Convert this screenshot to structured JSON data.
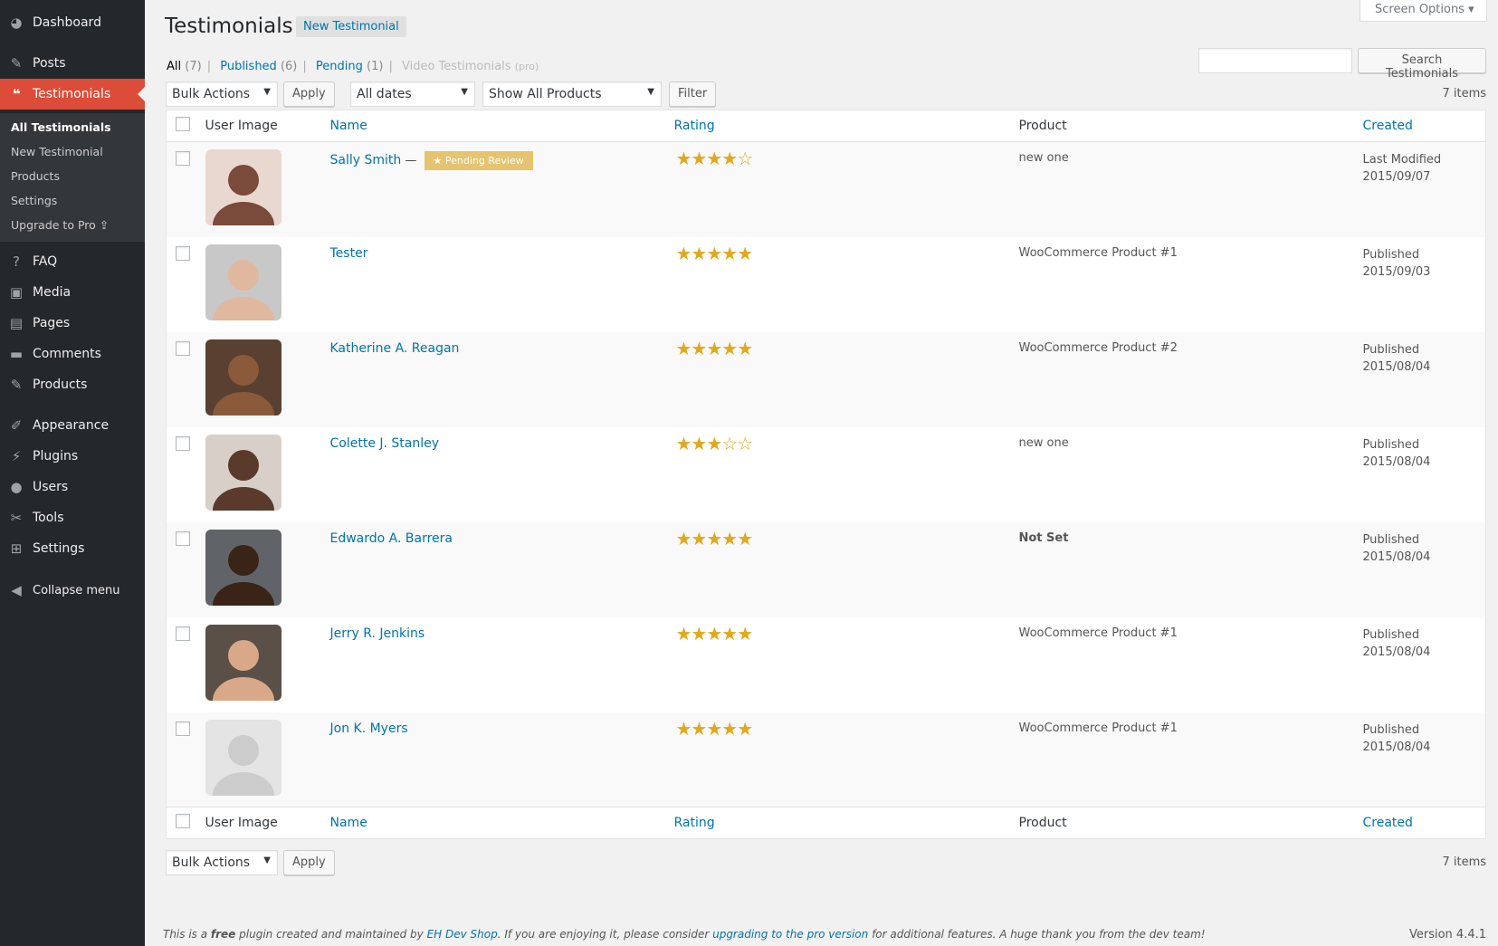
{
  "sidebar": {
    "items": [
      {
        "label": "Dashboard",
        "icon": "dashboard-icon",
        "glyph": "◕"
      },
      {
        "label": "Posts",
        "icon": "pin-icon",
        "glyph": "✎"
      },
      {
        "label": "Testimonials",
        "icon": "quote-icon",
        "glyph": "❝"
      },
      {
        "label": "FAQ",
        "icon": "question-icon",
        "glyph": "?"
      },
      {
        "label": "Media",
        "icon": "media-icon",
        "glyph": "▣"
      },
      {
        "label": "Pages",
        "icon": "pages-icon",
        "glyph": "▤"
      },
      {
        "label": "Comments",
        "icon": "comment-icon",
        "glyph": "▬"
      },
      {
        "label": "Products",
        "icon": "pin-icon",
        "glyph": "✎"
      },
      {
        "label": "Appearance",
        "icon": "brush-icon",
        "glyph": "✐"
      },
      {
        "label": "Plugins",
        "icon": "plug-icon",
        "glyph": "⚡"
      },
      {
        "label": "Users",
        "icon": "user-icon",
        "glyph": "●"
      },
      {
        "label": "Tools",
        "icon": "wrench-icon",
        "glyph": "✂"
      },
      {
        "label": "Settings",
        "icon": "settings-icon",
        "glyph": "⊞"
      },
      {
        "label": "Collapse menu",
        "icon": "collapse-icon",
        "glyph": "◀"
      }
    ],
    "submenu": [
      "All Testimonials",
      "New Testimonial",
      "Products",
      "Settings",
      "Upgrade to Pro"
    ]
  },
  "header": {
    "title": "Testimonials",
    "add_new": "New Testimonial",
    "screen_options": "Screen Options ▾"
  },
  "filters": {
    "all": "All",
    "all_count": "(7)",
    "published": "Published",
    "published_count": "(6)",
    "pending": "Pending",
    "pending_count": "(1)",
    "video": "Video Testimonials",
    "video_note": "(pro)"
  },
  "search": {
    "value": "",
    "button": "Search Testimonials"
  },
  "toolbar": {
    "bulk": "Bulk Actions",
    "apply": "Apply",
    "dates": "All dates",
    "products": "Show All Products",
    "filter": "Filter",
    "count": "7 items"
  },
  "columns": {
    "image": "User Image",
    "name": "Name",
    "rating": "Rating",
    "product": "Product",
    "created": "Created"
  },
  "rows": [
    {
      "name": "Sally Smith",
      "badge": "★ Pending Review",
      "sep": " — ",
      "rating": 4,
      "stars": "★★★★☆",
      "product": "new one",
      "status": "Last Modified",
      "date": "2015/09/07",
      "bg": "#e8d8d0",
      "fg": "#7a4a3a"
    },
    {
      "name": "Tester",
      "rating": 5,
      "stars": "★★★★★",
      "product": "WooCommerce Product #1",
      "status": "Published",
      "date": "2015/09/03",
      "bg": "#c8c8c8",
      "fg": "#e0b8a0"
    },
    {
      "name": "Katherine A. Reagan",
      "rating": 5,
      "stars": "★★★★★",
      "product": "WooCommerce Product #2",
      "status": "Published",
      "date": "2015/08/04",
      "bg": "#5a4030",
      "fg": "#8a5a3a"
    },
    {
      "name": "Colette J. Stanley",
      "rating": 3,
      "stars": "★★★☆☆",
      "product": "new one",
      "status": "Published",
      "date": "2015/08/04",
      "bg": "#d8d0c8",
      "fg": "#5a3a2a"
    },
    {
      "name": "Edwardo A. Barrera",
      "rating": 5,
      "stars": "★★★★★",
      "product": "Not Set",
      "status": "Published",
      "date": "2015/08/04",
      "bg": "#606468",
      "fg": "#3a2418"
    },
    {
      "name": "Jerry R. Jenkins",
      "rating": 5,
      "stars": "★★★★★",
      "product": "WooCommerce Product #1",
      "status": "Published",
      "date": "2015/08/04",
      "bg": "#5a5048",
      "fg": "#d8a888"
    },
    {
      "name": "Jon K. Myers",
      "rating": 5,
      "stars": "★★★★★",
      "product": "WooCommerce Product #1",
      "status": "Published",
      "date": "2015/08/04",
      "bg": "#e4e4e4",
      "fg": "#cccccc"
    }
  ],
  "footer": {
    "t1": "This is a ",
    "free": "free",
    "t2": " plugin created and maintained by ",
    "link1": "EH Dev Shop",
    "t3": ". If you are enjoying it, please consider ",
    "link2": "upgrading to the pro version",
    "t4": " for additional features. A huge thank you from the dev team!",
    "version": "Version 4.4.1"
  }
}
